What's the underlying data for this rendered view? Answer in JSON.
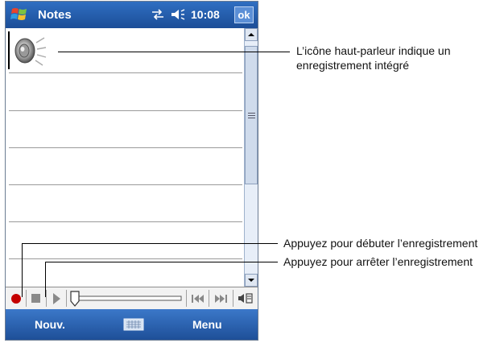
{
  "titlebar": {
    "app_title": "Notes",
    "time": "10:08",
    "ok_label": "ok",
    "icons": [
      "windows-flag-icon",
      "connectivity-icon",
      "volume-icon"
    ]
  },
  "note": {
    "embedded_item_icon": "speaker-icon"
  },
  "recording_toolbar": {
    "icons": [
      "record-icon",
      "stop-icon",
      "play-icon",
      "volume-slider",
      "skip-back-icon",
      "skip-forward-icon",
      "speaker-toggle-icon"
    ]
  },
  "menubar": {
    "new_label": "Nouv.",
    "menu_label": "Menu",
    "icons": [
      "keyboard-icon"
    ]
  },
  "annotations": {
    "speaker": "L’icône haut-parleur indique un enregistrement intégré",
    "speaker_line1": "L’icône haut-parleur indique un",
    "speaker_line2": "enregistrement intégré",
    "record": "Appuyez pour débuter l’enregistrement",
    "stop": "Appuyez pour arrêter l’enregistrement"
  },
  "colors": {
    "title_bar": "#1c4e97",
    "record_red": "#c40000"
  }
}
